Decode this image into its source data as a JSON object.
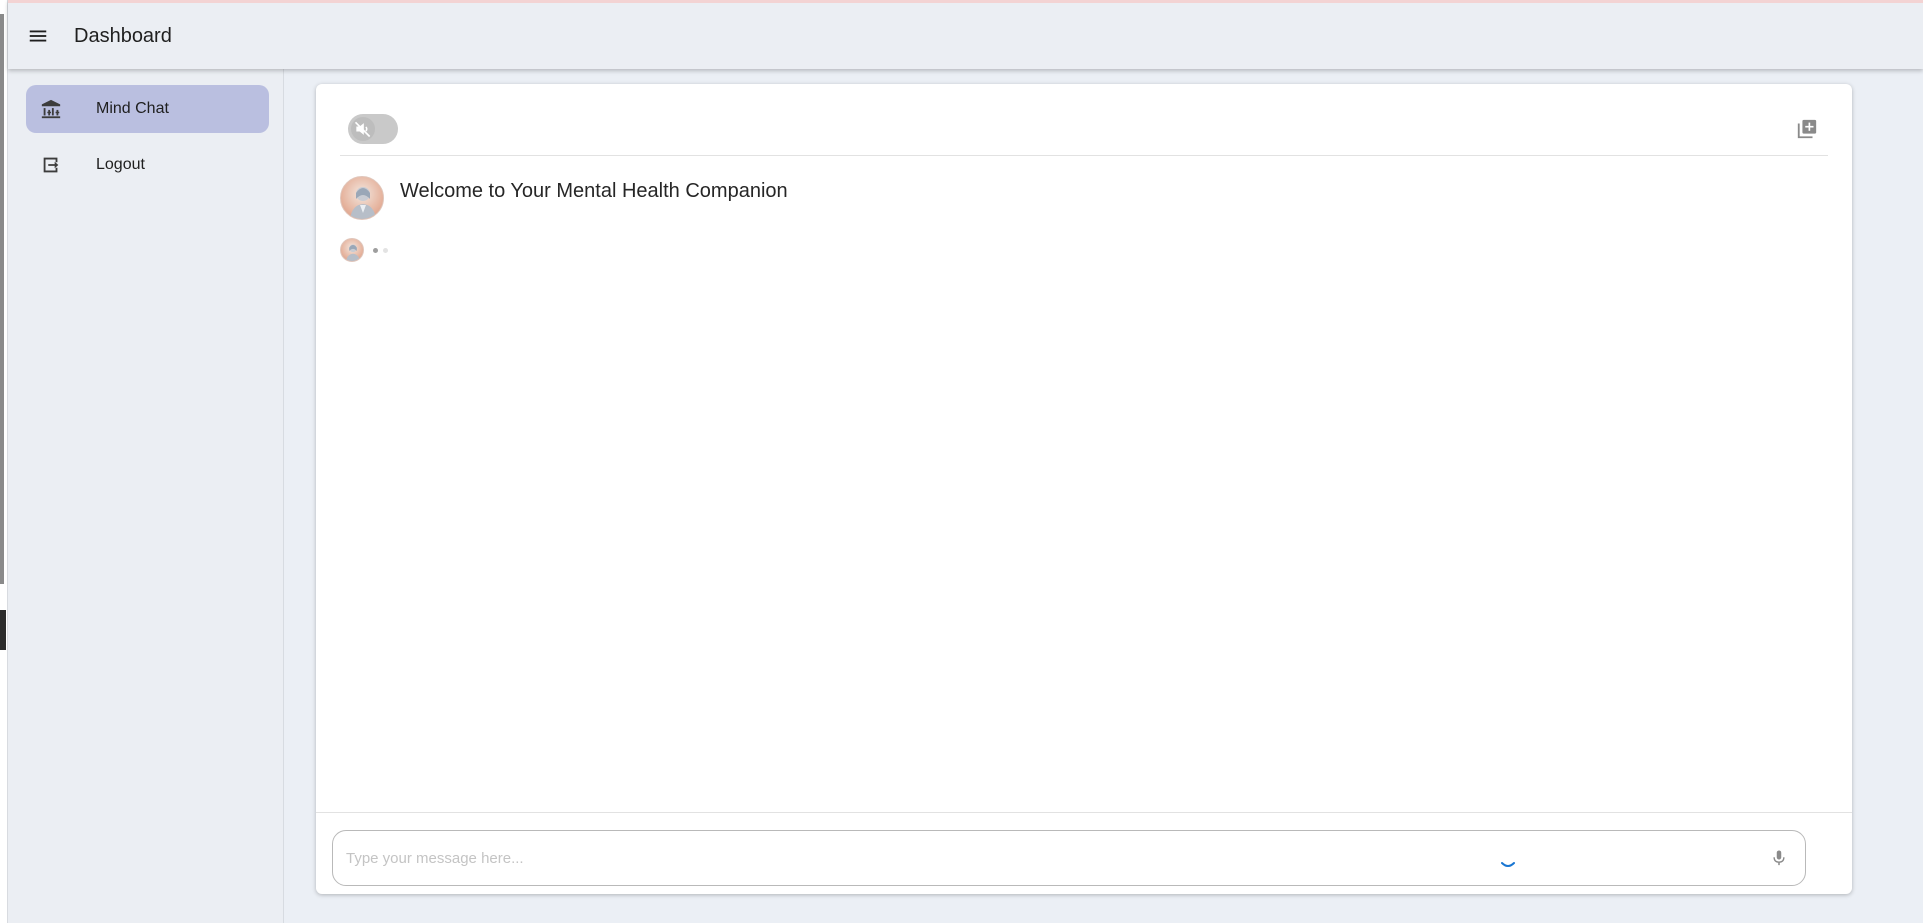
{
  "appbar": {
    "title": "Dashboard",
    "menu_icon": "hamburger-menu-icon"
  },
  "sidebar": {
    "items": [
      {
        "label": "Mind Chat",
        "icon": "institution-icon",
        "active": true
      },
      {
        "label": "Logout",
        "icon": "logout-icon",
        "active": false
      }
    ]
  },
  "chat": {
    "mute_icon": "volume-off-icon",
    "mute_on": false,
    "new_chat_icon": "add-box-icon",
    "welcome_message": "Welcome to Your Mental Health Companion",
    "bot_avatar": "bot-avatar-image"
  },
  "composer": {
    "placeholder": "Type your message here...",
    "value": "",
    "mic_icon": "microphone-icon",
    "status_icon": "loading-spinner-icon"
  },
  "colors": {
    "accent": "#1976d2",
    "active_nav": "#babfe0",
    "background": "#ebeef3"
  }
}
